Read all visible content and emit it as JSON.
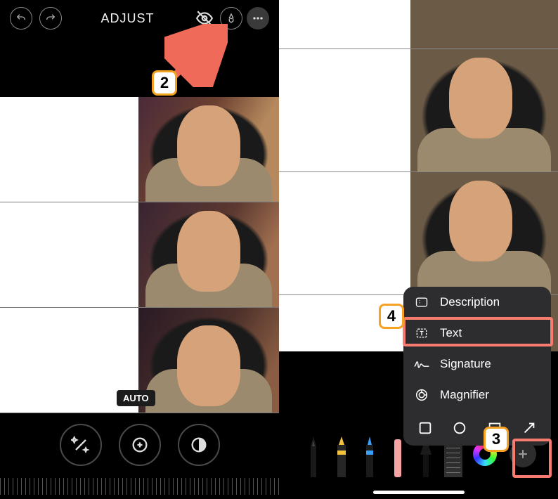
{
  "left": {
    "title": "ADJUST",
    "auto_badge": "AUTO"
  },
  "right": {
    "menu": {
      "items": [
        {
          "label": "Description"
        },
        {
          "label": "Text"
        },
        {
          "label": "Signature"
        },
        {
          "label": "Magnifier"
        }
      ]
    }
  },
  "callouts": {
    "c2": "2",
    "c3": "3",
    "c4": "4"
  }
}
